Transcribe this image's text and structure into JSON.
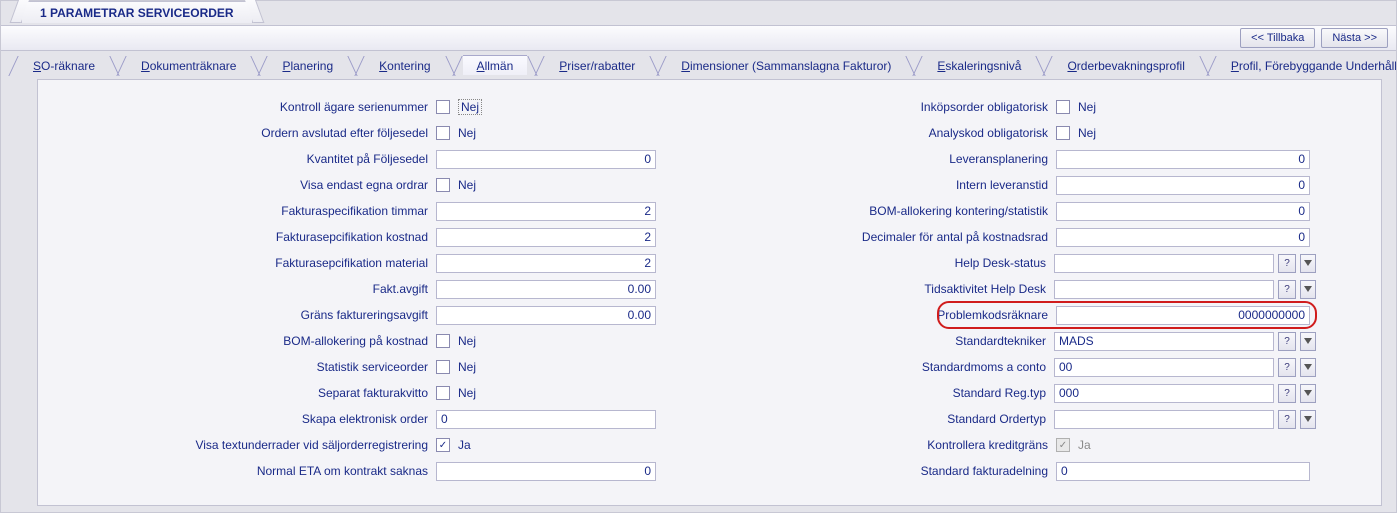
{
  "header": {
    "title": "1 PARAMETRAR SERVICEORDER"
  },
  "toolbar": {
    "back": "<< Tillbaka",
    "next": "Nästa >>"
  },
  "tabs": [
    "SO-räknare",
    "Dokumenträknare",
    "Planering",
    "Kontering",
    "Allmän",
    "Priser/rabatter",
    "Dimensioner (Sammanslagna Fakturor)",
    "Eskaleringsnivå",
    "Orderbevakningsprofil",
    "Profil, Förebyggande Underhåll"
  ],
  "tabs_underline_idx": [
    0,
    0,
    0,
    0,
    0,
    0,
    0,
    0,
    0,
    0
  ],
  "active_tab": 4,
  "chk_no": "Nej",
  "chk_yes": "Ja",
  "left": {
    "kontroll_label": "Kontroll ägare serienummer",
    "kontroll_val": false,
    "order_avslutad_label": "Ordern avslutad efter följesedel",
    "order_avslutad_val": false,
    "kvantitet_label": "Kvantitet på Följesedel",
    "kvantitet_val": "0",
    "visa_endast_label": "Visa endast egna ordrar",
    "visa_endast_val": false,
    "faktspec_timmar_label": "Fakturaspecifikation timmar",
    "faktspec_timmar_val": "2",
    "faktspec_kostnad_label": "Fakturasepcifikation kostnad",
    "faktspec_kostnad_val": "2",
    "faktspec_material_label": "Fakturasepcifikation material",
    "faktspec_material_val": "2",
    "fakt_avgift_label": "Fakt.avgift",
    "fakt_avgift_val": "0.00",
    "grans_label": "Gräns faktureringsavgift",
    "grans_val": "0.00",
    "bom_kostnad_label": "BOM-allokering på kostnad",
    "bom_kostnad_val": false,
    "statistik_label": "Statistik serviceorder",
    "statistik_val": false,
    "separat_label": "Separat fakturakvitto",
    "separat_val": false,
    "skapa_elek_label": "Skapa elektronisk order",
    "skapa_elek_val": "0",
    "visa_text_label": "Visa textunderrader vid säljorderregistrering",
    "visa_text_val": true,
    "normal_eta_label": "Normal ETA om kontrakt saknas",
    "normal_eta_val": "0"
  },
  "right": {
    "inkop_label": "Inköpsorder obligatorisk",
    "inkop_val": false,
    "analys_label": "Analyskod obligatorisk",
    "analys_val": false,
    "leverans_label": "Leveransplanering",
    "leverans_val": "0",
    "intern_label": "Intern leveranstid",
    "intern_val": "0",
    "bom_stat_label": "BOM-allokering kontering/statistik",
    "bom_stat_val": "0",
    "decimaler_label": "Decimaler för antal på kostnadsrad",
    "decimaler_val": "0",
    "helpdesk_label": "Help Desk-status",
    "helpdesk_val": "",
    "tids_label": "Tidsaktivitet Help Desk",
    "tids_val": "",
    "problem_label": "Problemkodsräknare",
    "problem_val": "0000000000",
    "stdtek_label": "Standardtekniker",
    "stdtek_val": "MADS",
    "stdmoms_label": "Standardmoms a conto",
    "stdmoms_val": "00",
    "stdreg_label": "Standard Reg.typ",
    "stdreg_val": "000",
    "stdorder_label": "Standard Ordertyp",
    "stdorder_val": "",
    "kredit_label": "Kontrollera kreditgräns",
    "kredit_val": true,
    "stdfakt_label": "Standard fakturadelning",
    "stdfakt_val": "0"
  },
  "lookup_q": "?"
}
